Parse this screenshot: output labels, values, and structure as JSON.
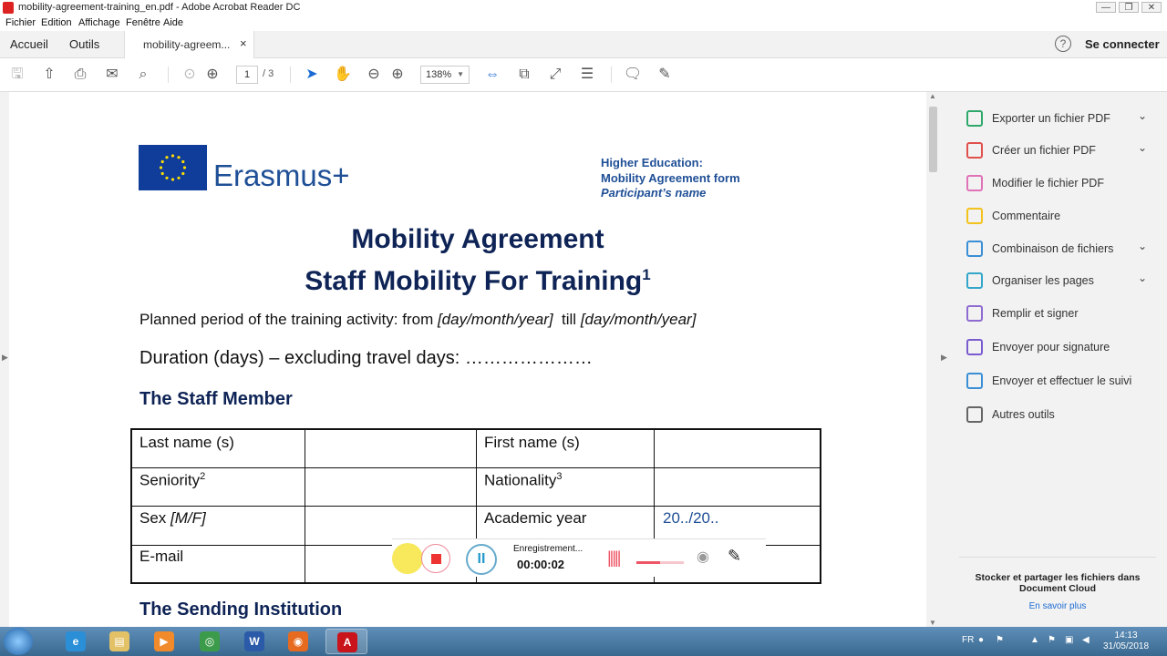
{
  "window": {
    "title": "mobility-agreement-training_en.pdf - Adobe Acrobat Reader DC",
    "minimize": "—",
    "restore": "❐",
    "close": "✕"
  },
  "menu": [
    "Fichier",
    "Edition",
    "Affichage",
    "Fenêtre",
    "Aide"
  ],
  "tabs": {
    "home": "Accueil",
    "tools": "Outils",
    "document": "mobility-agreem...",
    "close": "×",
    "help": "?",
    "signin": "Se connecter"
  },
  "toolbar": {
    "page_current": "1",
    "page_total": "/ 3",
    "zoom": "138%",
    "icons": [
      "save-icon",
      "upload-icon",
      "print-icon",
      "mail-icon",
      "search-icon",
      "page-up-icon",
      "page-down-icon",
      "select-cursor-icon",
      "hand-icon",
      "zoom-out-icon",
      "zoom-in-icon",
      "fit-width-icon",
      "fit-page-icon",
      "fullscreen-icon",
      "scroll-mode-icon",
      "comment-icon",
      "pen-icon"
    ]
  },
  "document": {
    "brand": "Erasmus+",
    "header_line1": "Higher Education:",
    "header_line2": "Mobility Agreement form",
    "header_line3": "Participant’s name",
    "title1": "Mobility Agreement",
    "title2": "Staff Mobility For Training",
    "title2_note": "1",
    "planned_prefix": "Planned period of the training activity: from ",
    "planned_from": "[day/month/year]",
    "planned_mid": "  till ",
    "planned_till": "[day/month/year]",
    "duration": "Duration (days) – excluding travel days: …………………",
    "section_staff": "The Staff Member",
    "section_sending": "The Sending Institution",
    "staff_table": {
      "last_name": "Last name (s)",
      "first_name": "First name (s)",
      "seniority": "Seniority",
      "seniority_note": "2",
      "nationality": "Nationality",
      "nationality_note": "3",
      "sex": "Sex ",
      "sex_options": "[M/F]",
      "academic_year": "Academic year",
      "academic_year_value": "20../20..",
      "email": "E-mail"
    }
  },
  "recorder": {
    "status": "Enregistrement...",
    "time": "00:00:02",
    "pause": "II"
  },
  "sidepanel": {
    "tools": [
      {
        "label": "Exporter un fichier PDF",
        "icon": "export-pdf-icon",
        "color": "#2fa86b",
        "expandable": true
      },
      {
        "label": "Créer un fichier PDF",
        "icon": "create-pdf-icon",
        "color": "#e0504d",
        "expandable": true
      },
      {
        "label": "Modifier le fichier PDF",
        "icon": "edit-pdf-icon",
        "color": "#e072b8",
        "expandable": false
      },
      {
        "label": "Commentaire",
        "icon": "comment-icon",
        "color": "#f4c21c",
        "expandable": false
      },
      {
        "label": "Combinaison de fichiers",
        "icon": "combine-files-icon",
        "color": "#3a8fd6",
        "expandable": true
      },
      {
        "label": "Organiser les pages",
        "icon": "organize-pages-icon",
        "color": "#33a6c9",
        "expandable": true
      },
      {
        "label": "Remplir et signer",
        "icon": "fill-sign-icon",
        "color": "#8e6bd1",
        "expandable": false
      },
      {
        "label": "Envoyer pour signature",
        "icon": "send-signature-icon",
        "color": "#7b5bd0",
        "expandable": false
      },
      {
        "label": "Envoyer et effectuer le suivi",
        "icon": "send-track-icon",
        "color": "#3a8fd6",
        "expandable": false
      },
      {
        "label": "Autres outils",
        "icon": "more-tools-icon",
        "color": "#666666",
        "expandable": false
      }
    ],
    "chevron": "⌄",
    "cloud_text": "Stocker et partager les fichiers dans Document Cloud",
    "cloud_link": "En savoir plus"
  },
  "taskbar": {
    "apps": [
      {
        "name": "internet-explorer",
        "glyph": "e",
        "color": "#2b8fd8"
      },
      {
        "name": "file-explorer",
        "glyph": "▤",
        "color": "#e3c167"
      },
      {
        "name": "media-player",
        "glyph": "▶",
        "color": "#f08a2a"
      },
      {
        "name": "chrome",
        "glyph": "◎",
        "color": "#3c9b4a"
      },
      {
        "name": "word",
        "glyph": "W",
        "color": "#2a5aa8"
      },
      {
        "name": "firefox",
        "glyph": "◉",
        "color": "#e66a1f"
      },
      {
        "name": "acrobat",
        "glyph": "A",
        "color": "#c8141a"
      }
    ],
    "lang": "FR",
    "time": "14:13",
    "date": "31/05/2018"
  }
}
